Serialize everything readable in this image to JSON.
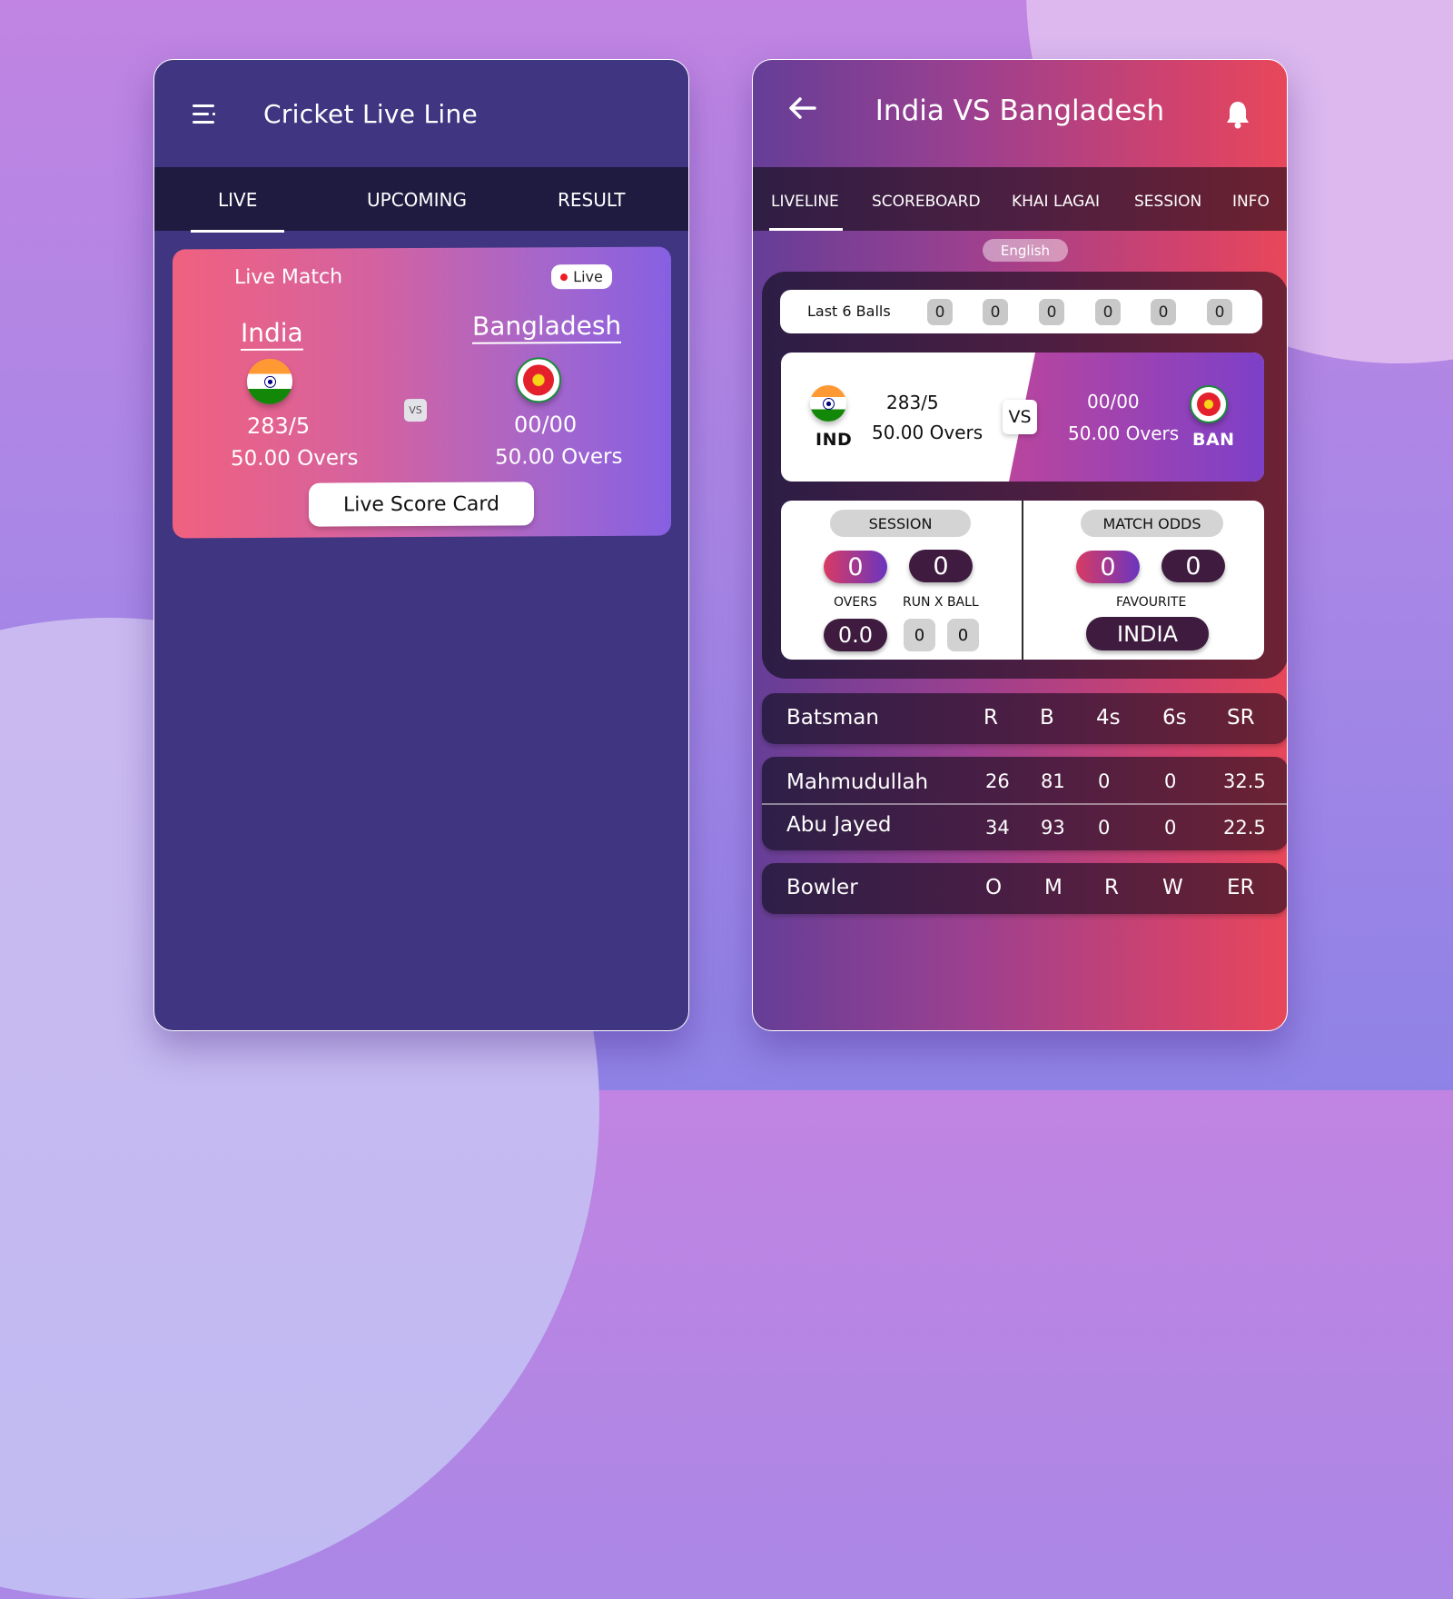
{
  "left_app": {
    "title": "Cricket Live Line",
    "menu_icon": "hamburger-menu-icon",
    "tabs": [
      {
        "label": "LIVE",
        "active": true
      },
      {
        "label": "UPCOMING",
        "active": false
      },
      {
        "label": "RESULT",
        "active": false
      }
    ],
    "match_card": {
      "label": "Live Match",
      "live_badge": "Live",
      "team1": {
        "name": "India",
        "score": "283/5",
        "overs": "50.00 Overs",
        "flag": "india-flag-icon"
      },
      "team2": {
        "name": "Bangladesh",
        "score": "00/00",
        "overs": "50.00 Overs",
        "flag": "bangladesh-emblem-icon"
      },
      "vs": "VS",
      "button": "Live Score Card"
    }
  },
  "right_app": {
    "title": "India VS Bangladesh",
    "back_icon": "back-arrow-icon",
    "bell_icon": "bell-icon",
    "tabs": [
      {
        "label": "LIVELINE",
        "active": true
      },
      {
        "label": "SCOREBOARD",
        "active": false
      },
      {
        "label": "KHAI LAGAI",
        "active": false
      },
      {
        "label": "SESSION",
        "active": false
      },
      {
        "label": "INFO",
        "active": false
      }
    ],
    "language": "English",
    "last_balls": {
      "label": "Last 6 Balls",
      "values": [
        "0",
        "0",
        "0",
        "0",
        "0",
        "0"
      ]
    },
    "scorecard": {
      "team1": {
        "code": "IND",
        "score": "283/5",
        "overs": "50.00 Overs"
      },
      "team2": {
        "code": "BAN",
        "score": "00/00",
        "overs": "50.00 Overs"
      },
      "vs": "VS"
    },
    "session": {
      "title": "SESSION",
      "values": [
        "0",
        "0"
      ],
      "overs_label": "OVERS",
      "overs_value": "0.0",
      "run_x_ball_label": "RUN X BALL",
      "run_x_ball_values": [
        "0",
        "0"
      ]
    },
    "match_odds": {
      "title": "MATCH ODDS",
      "values": [
        "0",
        "0"
      ],
      "favourite_label": "FAVOURITE",
      "favourite_value": "INDIA"
    },
    "batsman_table": {
      "headers": [
        "Batsman",
        "R",
        "B",
        "4s",
        "6s",
        "SR"
      ],
      "rows": [
        [
          "Mahmudullah",
          "26",
          "81",
          "0",
          "0",
          "32.5"
        ],
        [
          "Abu Jayed",
          "34",
          "93",
          "0",
          "0",
          "22.5"
        ]
      ]
    },
    "bowler_table": {
      "headers": [
        "Bowler",
        "O",
        "M",
        "R",
        "W",
        "ER"
      ]
    }
  }
}
